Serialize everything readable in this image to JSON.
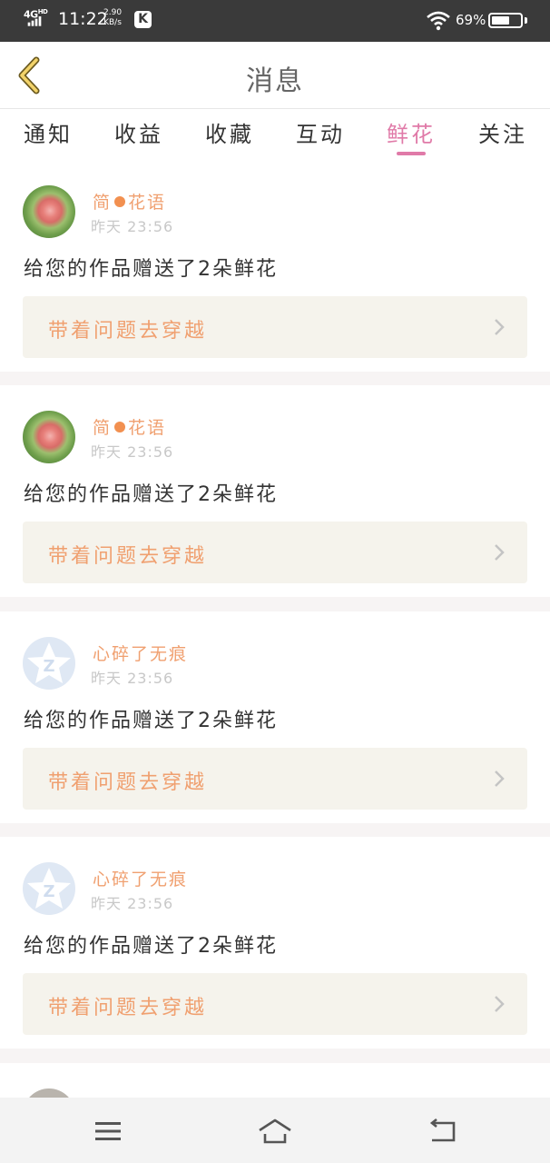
{
  "status_bar": {
    "network": "4G",
    "network_sup": "HD",
    "time": "11:22",
    "speed_value": "2.90",
    "speed_unit": "KB/s",
    "app_badge": "K",
    "battery": "69%",
    "battery_level": 0.69
  },
  "header": {
    "title": "消息",
    "back_icon": "chevron-left-icon"
  },
  "tabs": [
    {
      "label": "通知",
      "active": false
    },
    {
      "label": "收益",
      "active": false
    },
    {
      "label": "收藏",
      "active": false
    },
    {
      "label": "互动",
      "active": false
    },
    {
      "label": "鲜花",
      "active": true
    },
    {
      "label": "关注",
      "active": false
    }
  ],
  "colors": {
    "accent": "#e07aa8",
    "username": "#f0a070",
    "card_link_bg": "#f5f3ec"
  },
  "messages": [
    {
      "user_part1": "简",
      "user_part2": "花语",
      "avatar": "rose-avatar",
      "time": "昨天 23:56",
      "text": "给您的作品赠送了2朵鲜花",
      "work": "带着问题去穿越"
    },
    {
      "user_part1": "简",
      "user_part2": "花语",
      "avatar": "rose-avatar",
      "time": "昨天 23:56",
      "text": "给您的作品赠送了2朵鲜花",
      "work": "带着问题去穿越"
    },
    {
      "user": "心碎了无痕",
      "avatar": "default-avatar",
      "time": "昨天 23:56",
      "text": "给您的作品赠送了2朵鲜花",
      "work": "带着问题去穿越"
    },
    {
      "user": "心碎了无痕",
      "avatar": "default-avatar",
      "time": "昨天 23:56",
      "text": "给您的作品赠送了2朵鲜花",
      "work": "带着问题去穿越"
    }
  ],
  "navbar": {
    "menu_icon": "menu-icon",
    "home_icon": "home-icon",
    "back_icon": "back-icon"
  }
}
